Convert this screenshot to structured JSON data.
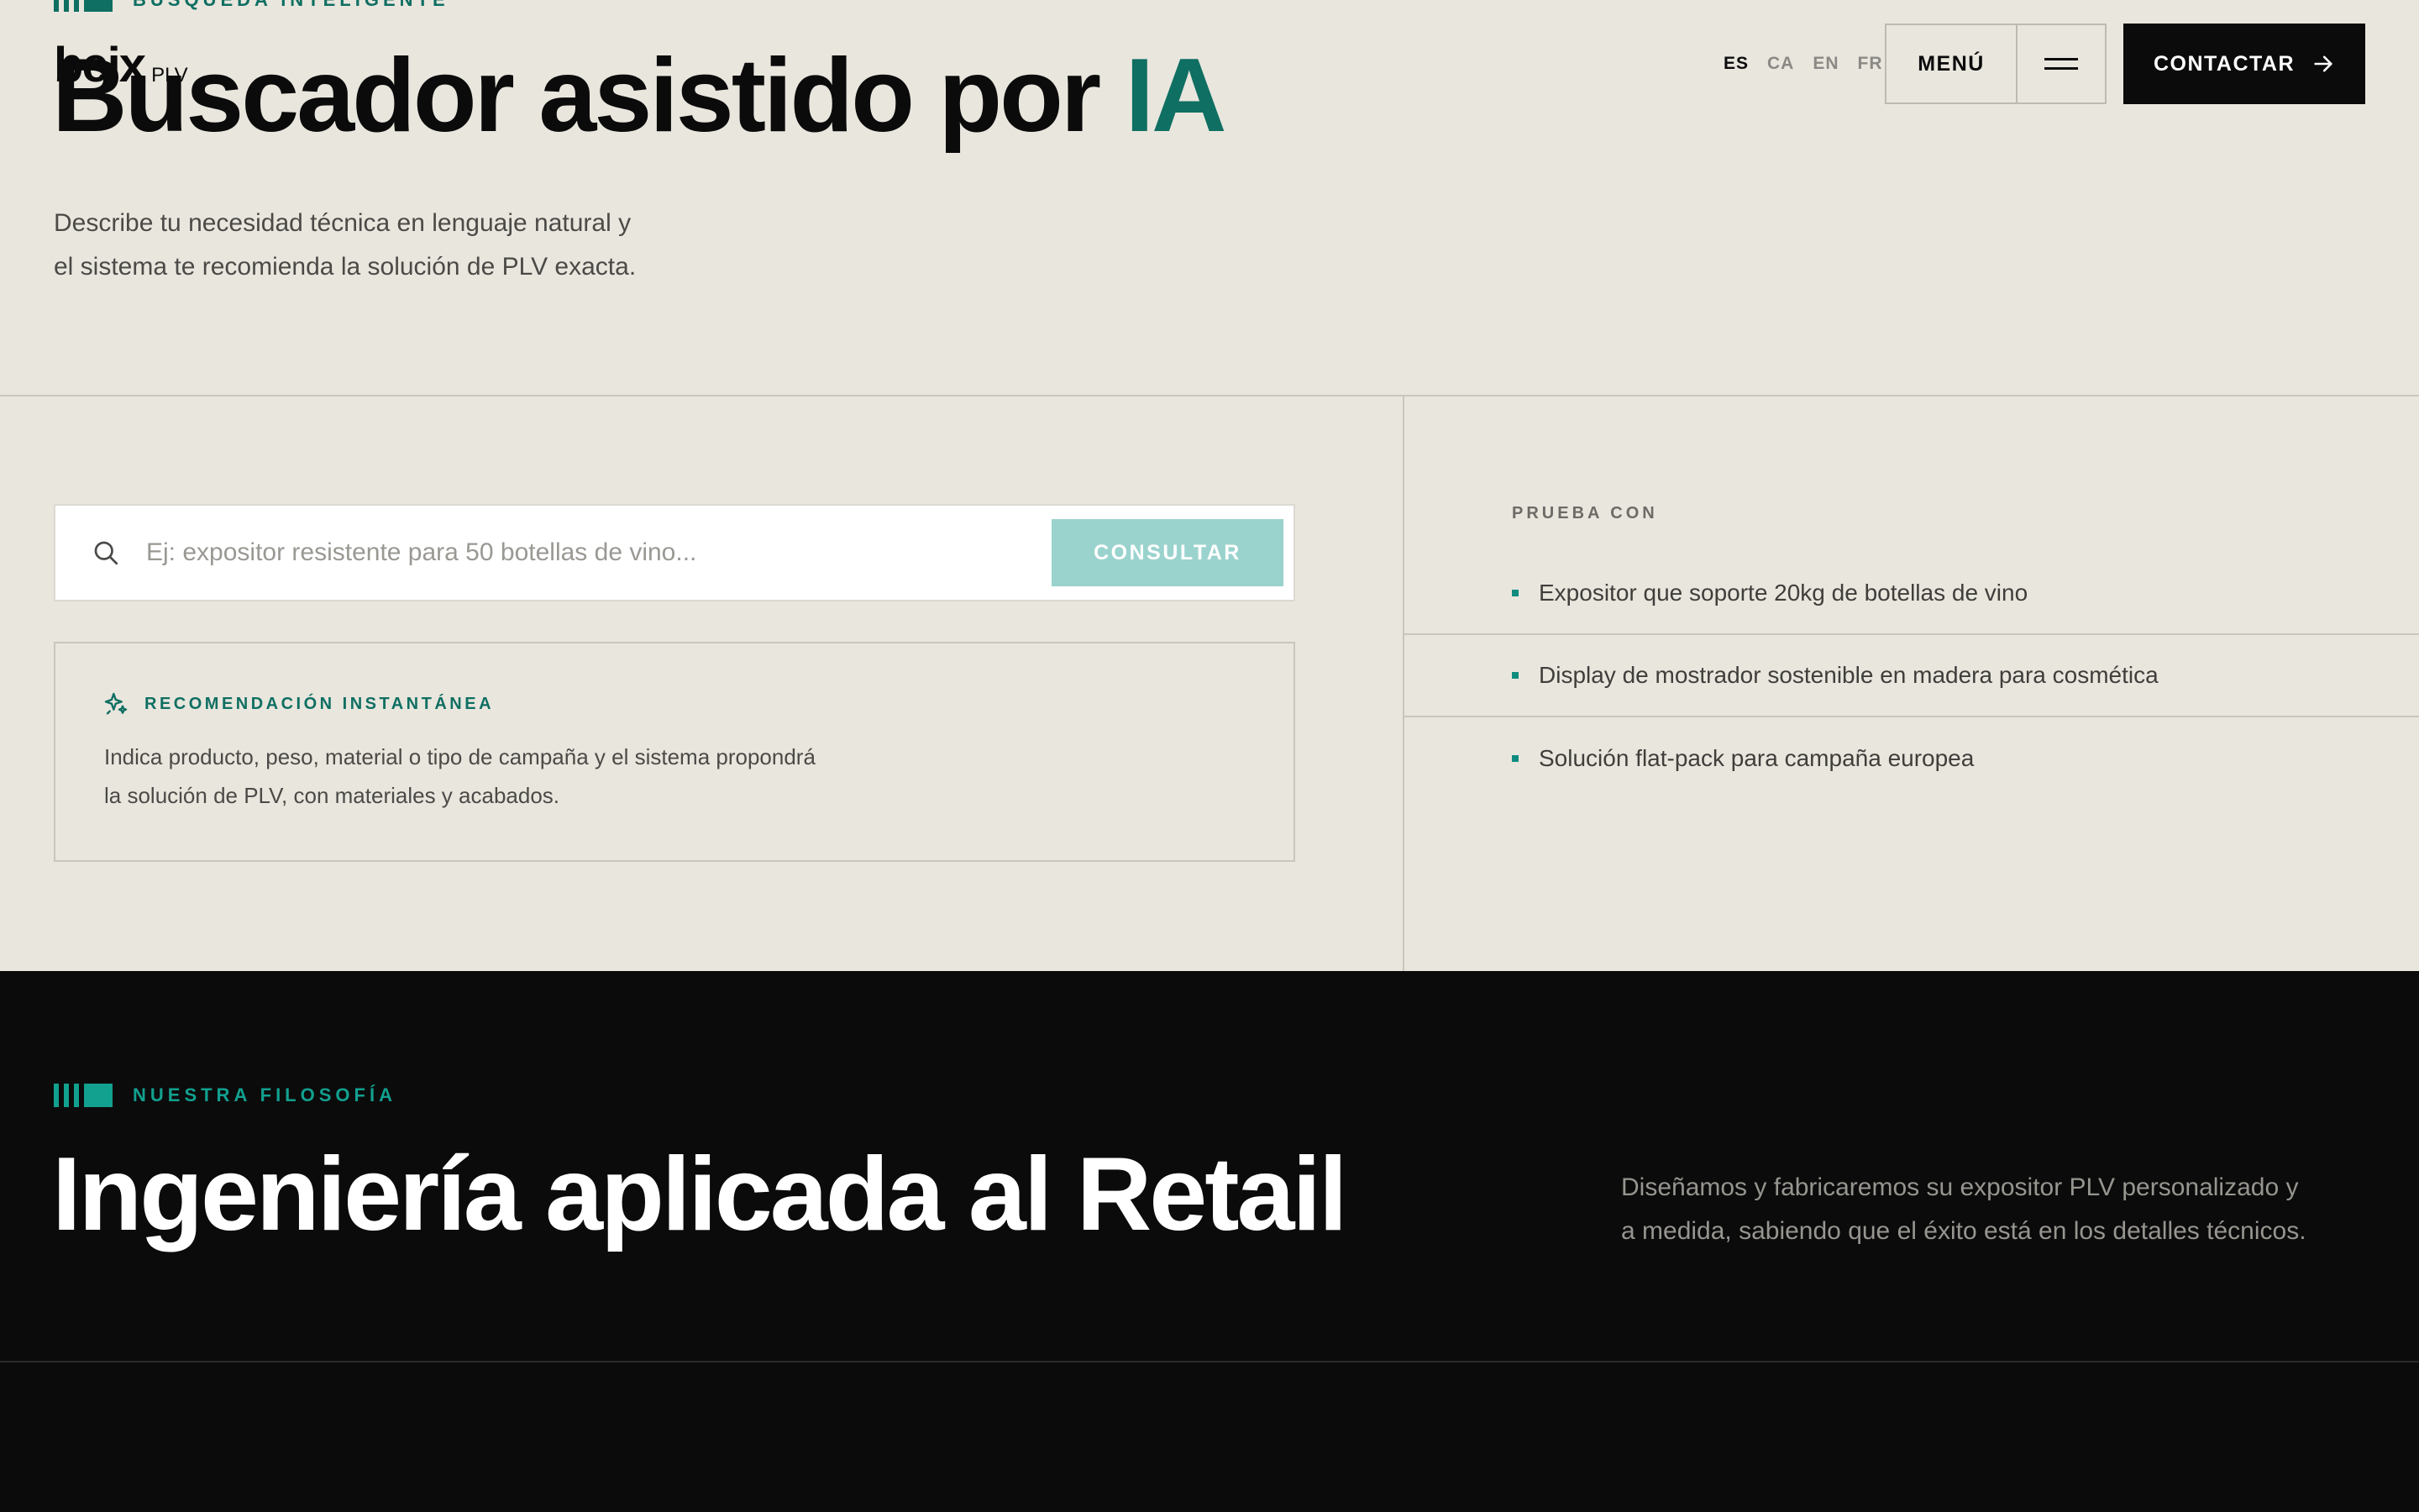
{
  "header": {
    "logo_word": "beix",
    "logo_sub": "PLV",
    "languages": [
      "ES",
      "CA",
      "EN",
      "FR"
    ],
    "menu_label": "MENÚ",
    "contact_label": "CONTACTAR"
  },
  "hero": {
    "eyebrow": "BÚSQUEDA INTELIGENTE",
    "title_main": "Buscador asistido por ",
    "title_accent": "IA",
    "description_line1": "Describe tu necesidad técnica en lenguaje natural y",
    "description_line2": "el sistema te recomienda la solución de PLV exacta."
  },
  "search": {
    "placeholder": "Ej: expositor resistente para 50 botellas de vino...",
    "button_label": "CONSULTAR"
  },
  "recommendation": {
    "title": "RECOMENDACIÓN INSTANTÁNEA",
    "line1": "Indica producto, peso, material o tipo de campaña y el sistema propondrá",
    "line2": "la solución de PLV, con materiales y acabados."
  },
  "try_with": {
    "label": "PRUEBA CON",
    "items": [
      "Expositor que soporte 20kg de botellas de vino",
      "Display de mostrador sostenible en madera para cosmética",
      "Solución flat-pack para campaña europea"
    ]
  },
  "philosophy": {
    "eyebrow": "NUESTRA FILOSOFÍA",
    "title": "Ingeniería aplicada al Retail",
    "description_line1": "Diseñamos y fabricaremos su expositor PLV personalizado y",
    "description_line2": "a medida, sabiendo que el éxito está en los detalles técnicos."
  },
  "colors": {
    "background": "#e9e6de",
    "accent": "#0f6f62",
    "dark": "#0b0b0b",
    "button_disabled": "#9ad3cd"
  }
}
